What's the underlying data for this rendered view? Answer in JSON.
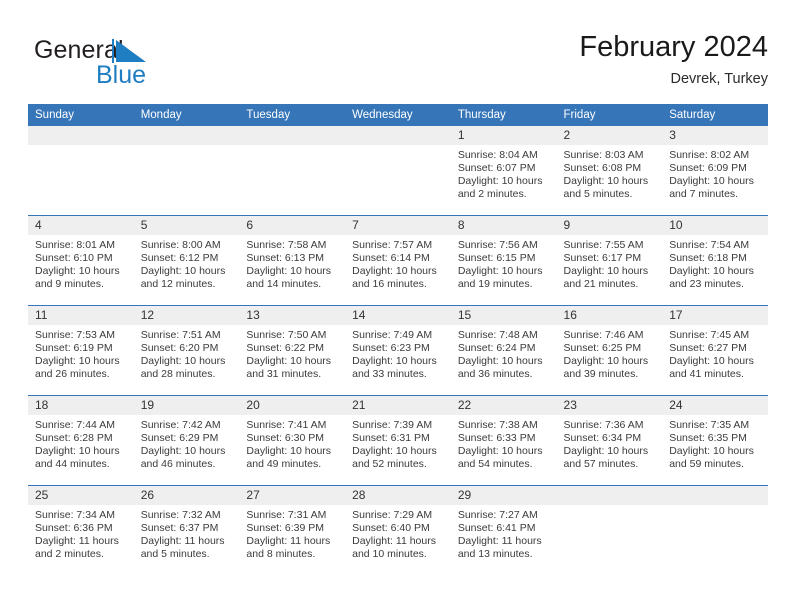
{
  "brand": {
    "name_part1": "General",
    "name_part2": "Blue",
    "accent_color": "#1f7dc1",
    "header_color": "#3575b8"
  },
  "header": {
    "title": "February 2024",
    "location": "Devrek, Turkey"
  },
  "calendar": {
    "weekday_headers": [
      "Sunday",
      "Monday",
      "Tuesday",
      "Wednesday",
      "Thursday",
      "Friday",
      "Saturday"
    ],
    "weeks": [
      [
        {
          "day": "",
          "empty": true,
          "sunrise": "",
          "sunset": "",
          "daylight_line1": "",
          "daylight_line2": ""
        },
        {
          "day": "",
          "empty": true,
          "sunrise": "",
          "sunset": "",
          "daylight_line1": "",
          "daylight_line2": ""
        },
        {
          "day": "",
          "empty": true,
          "sunrise": "",
          "sunset": "",
          "daylight_line1": "",
          "daylight_line2": ""
        },
        {
          "day": "",
          "empty": true,
          "sunrise": "",
          "sunset": "",
          "daylight_line1": "",
          "daylight_line2": ""
        },
        {
          "day": "1",
          "sunrise": "Sunrise: 8:04 AM",
          "sunset": "Sunset: 6:07 PM",
          "daylight_line1": "Daylight: 10 hours",
          "daylight_line2": "and 2 minutes."
        },
        {
          "day": "2",
          "sunrise": "Sunrise: 8:03 AM",
          "sunset": "Sunset: 6:08 PM",
          "daylight_line1": "Daylight: 10 hours",
          "daylight_line2": "and 5 minutes."
        },
        {
          "day": "3",
          "sunrise": "Sunrise: 8:02 AM",
          "sunset": "Sunset: 6:09 PM",
          "daylight_line1": "Daylight: 10 hours",
          "daylight_line2": "and 7 minutes."
        }
      ],
      [
        {
          "day": "4",
          "sunrise": "Sunrise: 8:01 AM",
          "sunset": "Sunset: 6:10 PM",
          "daylight_line1": "Daylight: 10 hours",
          "daylight_line2": "and 9 minutes."
        },
        {
          "day": "5",
          "sunrise": "Sunrise: 8:00 AM",
          "sunset": "Sunset: 6:12 PM",
          "daylight_line1": "Daylight: 10 hours",
          "daylight_line2": "and 12 minutes."
        },
        {
          "day": "6",
          "sunrise": "Sunrise: 7:58 AM",
          "sunset": "Sunset: 6:13 PM",
          "daylight_line1": "Daylight: 10 hours",
          "daylight_line2": "and 14 minutes."
        },
        {
          "day": "7",
          "sunrise": "Sunrise: 7:57 AM",
          "sunset": "Sunset: 6:14 PM",
          "daylight_line1": "Daylight: 10 hours",
          "daylight_line2": "and 16 minutes."
        },
        {
          "day": "8",
          "sunrise": "Sunrise: 7:56 AM",
          "sunset": "Sunset: 6:15 PM",
          "daylight_line1": "Daylight: 10 hours",
          "daylight_line2": "and 19 minutes."
        },
        {
          "day": "9",
          "sunrise": "Sunrise: 7:55 AM",
          "sunset": "Sunset: 6:17 PM",
          "daylight_line1": "Daylight: 10 hours",
          "daylight_line2": "and 21 minutes."
        },
        {
          "day": "10",
          "sunrise": "Sunrise: 7:54 AM",
          "sunset": "Sunset: 6:18 PM",
          "daylight_line1": "Daylight: 10 hours",
          "daylight_line2": "and 23 minutes."
        }
      ],
      [
        {
          "day": "11",
          "sunrise": "Sunrise: 7:53 AM",
          "sunset": "Sunset: 6:19 PM",
          "daylight_line1": "Daylight: 10 hours",
          "daylight_line2": "and 26 minutes."
        },
        {
          "day": "12",
          "sunrise": "Sunrise: 7:51 AM",
          "sunset": "Sunset: 6:20 PM",
          "daylight_line1": "Daylight: 10 hours",
          "daylight_line2": "and 28 minutes."
        },
        {
          "day": "13",
          "sunrise": "Sunrise: 7:50 AM",
          "sunset": "Sunset: 6:22 PM",
          "daylight_line1": "Daylight: 10 hours",
          "daylight_line2": "and 31 minutes."
        },
        {
          "day": "14",
          "sunrise": "Sunrise: 7:49 AM",
          "sunset": "Sunset: 6:23 PM",
          "daylight_line1": "Daylight: 10 hours",
          "daylight_line2": "and 33 minutes."
        },
        {
          "day": "15",
          "sunrise": "Sunrise: 7:48 AM",
          "sunset": "Sunset: 6:24 PM",
          "daylight_line1": "Daylight: 10 hours",
          "daylight_line2": "and 36 minutes."
        },
        {
          "day": "16",
          "sunrise": "Sunrise: 7:46 AM",
          "sunset": "Sunset: 6:25 PM",
          "daylight_line1": "Daylight: 10 hours",
          "daylight_line2": "and 39 minutes."
        },
        {
          "day": "17",
          "sunrise": "Sunrise: 7:45 AM",
          "sunset": "Sunset: 6:27 PM",
          "daylight_line1": "Daylight: 10 hours",
          "daylight_line2": "and 41 minutes."
        }
      ],
      [
        {
          "day": "18",
          "sunrise": "Sunrise: 7:44 AM",
          "sunset": "Sunset: 6:28 PM",
          "daylight_line1": "Daylight: 10 hours",
          "daylight_line2": "and 44 minutes."
        },
        {
          "day": "19",
          "sunrise": "Sunrise: 7:42 AM",
          "sunset": "Sunset: 6:29 PM",
          "daylight_line1": "Daylight: 10 hours",
          "daylight_line2": "and 46 minutes."
        },
        {
          "day": "20",
          "sunrise": "Sunrise: 7:41 AM",
          "sunset": "Sunset: 6:30 PM",
          "daylight_line1": "Daylight: 10 hours",
          "daylight_line2": "and 49 minutes."
        },
        {
          "day": "21",
          "sunrise": "Sunrise: 7:39 AM",
          "sunset": "Sunset: 6:31 PM",
          "daylight_line1": "Daylight: 10 hours",
          "daylight_line2": "and 52 minutes."
        },
        {
          "day": "22",
          "sunrise": "Sunrise: 7:38 AM",
          "sunset": "Sunset: 6:33 PM",
          "daylight_line1": "Daylight: 10 hours",
          "daylight_line2": "and 54 minutes."
        },
        {
          "day": "23",
          "sunrise": "Sunrise: 7:36 AM",
          "sunset": "Sunset: 6:34 PM",
          "daylight_line1": "Daylight: 10 hours",
          "daylight_line2": "and 57 minutes."
        },
        {
          "day": "24",
          "sunrise": "Sunrise: 7:35 AM",
          "sunset": "Sunset: 6:35 PM",
          "daylight_line1": "Daylight: 10 hours",
          "daylight_line2": "and 59 minutes."
        }
      ],
      [
        {
          "day": "25",
          "sunrise": "Sunrise: 7:34 AM",
          "sunset": "Sunset: 6:36 PM",
          "daylight_line1": "Daylight: 11 hours",
          "daylight_line2": "and 2 minutes."
        },
        {
          "day": "26",
          "sunrise": "Sunrise: 7:32 AM",
          "sunset": "Sunset: 6:37 PM",
          "daylight_line1": "Daylight: 11 hours",
          "daylight_line2": "and 5 minutes."
        },
        {
          "day": "27",
          "sunrise": "Sunrise: 7:31 AM",
          "sunset": "Sunset: 6:39 PM",
          "daylight_line1": "Daylight: 11 hours",
          "daylight_line2": "and 8 minutes."
        },
        {
          "day": "28",
          "sunrise": "Sunrise: 7:29 AM",
          "sunset": "Sunset: 6:40 PM",
          "daylight_line1": "Daylight: 11 hours",
          "daylight_line2": "and 10 minutes."
        },
        {
          "day": "29",
          "sunrise": "Sunrise: 7:27 AM",
          "sunset": "Sunset: 6:41 PM",
          "daylight_line1": "Daylight: 11 hours",
          "daylight_line2": "and 13 minutes."
        },
        {
          "day": "",
          "empty": true,
          "sunrise": "",
          "sunset": "",
          "daylight_line1": "",
          "daylight_line2": ""
        },
        {
          "day": "",
          "empty": true,
          "sunrise": "",
          "sunset": "",
          "daylight_line1": "",
          "daylight_line2": ""
        }
      ]
    ]
  }
}
